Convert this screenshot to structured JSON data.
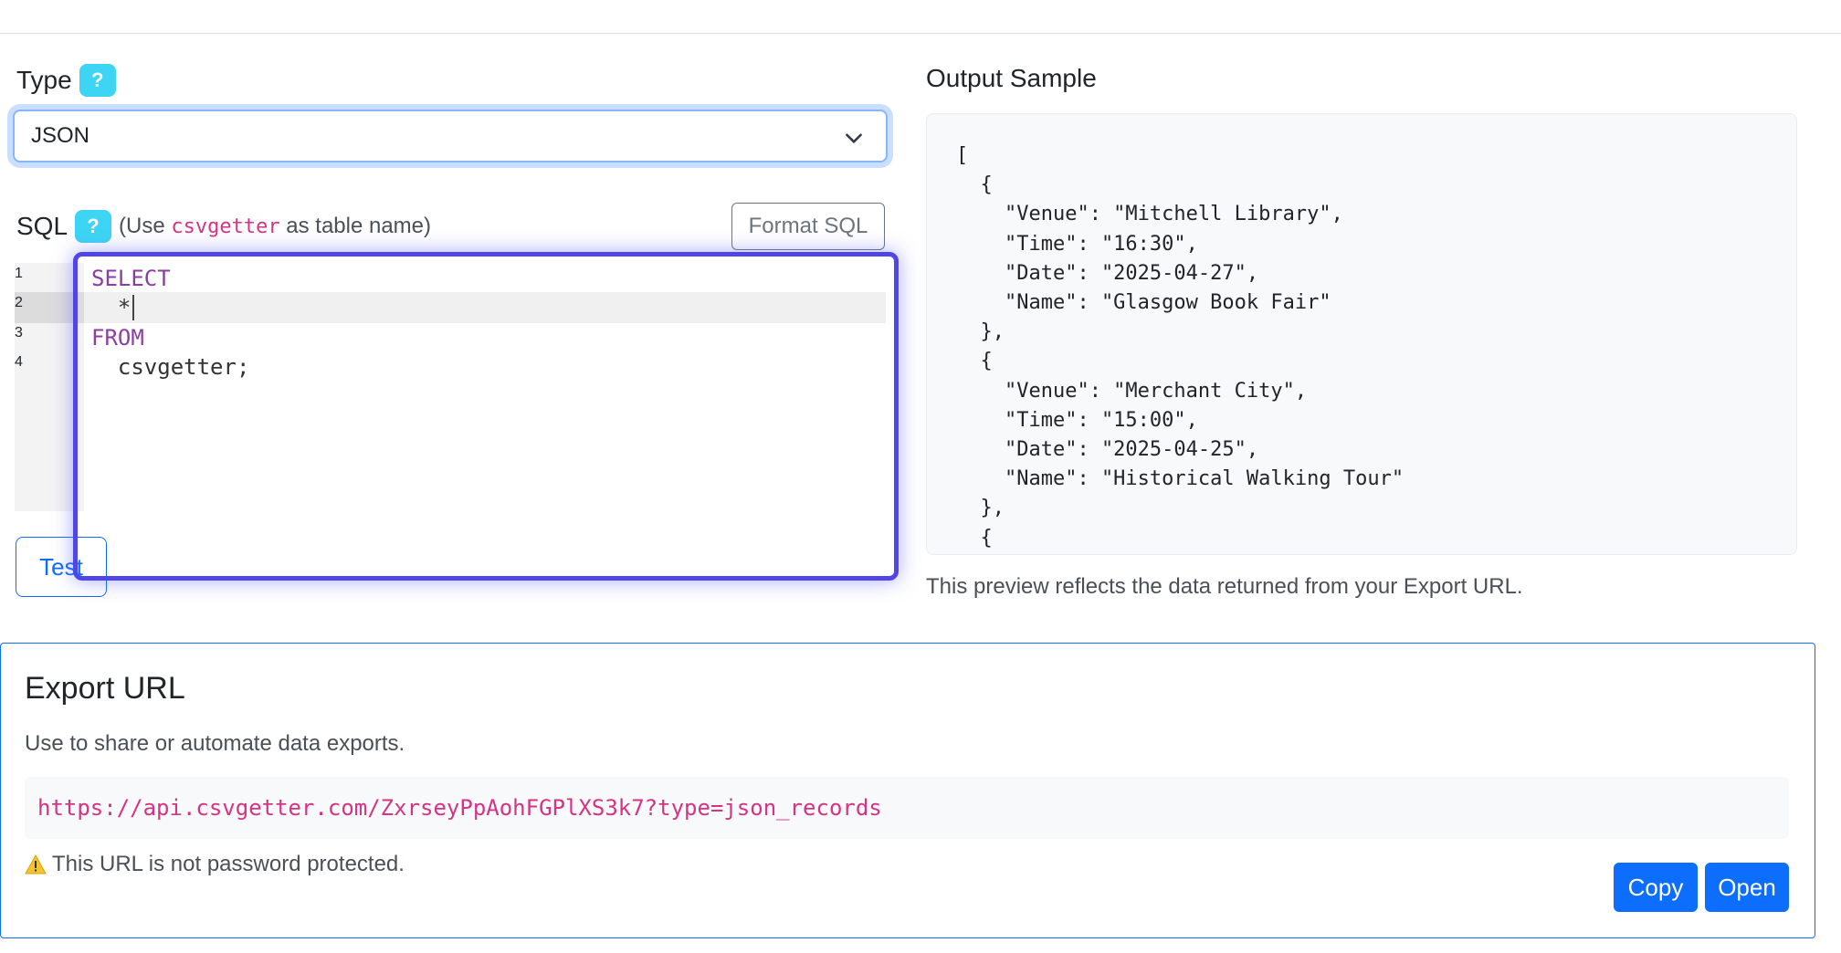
{
  "type_field": {
    "label": "Type",
    "help": "?",
    "selected": "JSON"
  },
  "sql_field": {
    "label": "SQL",
    "help": "?",
    "hint_prefix": "(Use ",
    "hint_code": "csvgetter",
    "hint_suffix": " as table name)",
    "format_button": "Format SQL",
    "line_numbers": [
      "1",
      "2",
      "3",
      "4"
    ],
    "lines": [
      "SELECT",
      "  *",
      "FROM",
      "  csvgetter;"
    ]
  },
  "test_button": "Test",
  "output": {
    "title": "Output Sample",
    "sample": "[\n  {\n    \"Venue\": \"Mitchell Library\",\n    \"Time\": \"16:30\",\n    \"Date\": \"2025-04-27\",\n    \"Name\": \"Glasgow Book Fair\"\n  },\n  {\n    \"Venue\": \"Merchant City\",\n    \"Time\": \"15:00\",\n    \"Date\": \"2025-04-25\",\n    \"Name\": \"Historical Walking Tour\"\n  },\n  {",
    "note": "This preview reflects the data returned from your Export URL."
  },
  "export": {
    "title": "Export URL",
    "description": "Use to share or automate data exports.",
    "url": "https://api.csvgetter.com/ZxrseyPpAohFGPlXS3k7?type=json_records",
    "warning": "This URL is not password protected.",
    "copy_button": "Copy",
    "open_button": "Open"
  },
  "colors": {
    "primary": "#0d6efd",
    "help_badge": "#3dd5f3",
    "code_pink": "#d63384",
    "editor_highlight": "#4f46e5",
    "sql_keyword": "#8a3fa0"
  }
}
